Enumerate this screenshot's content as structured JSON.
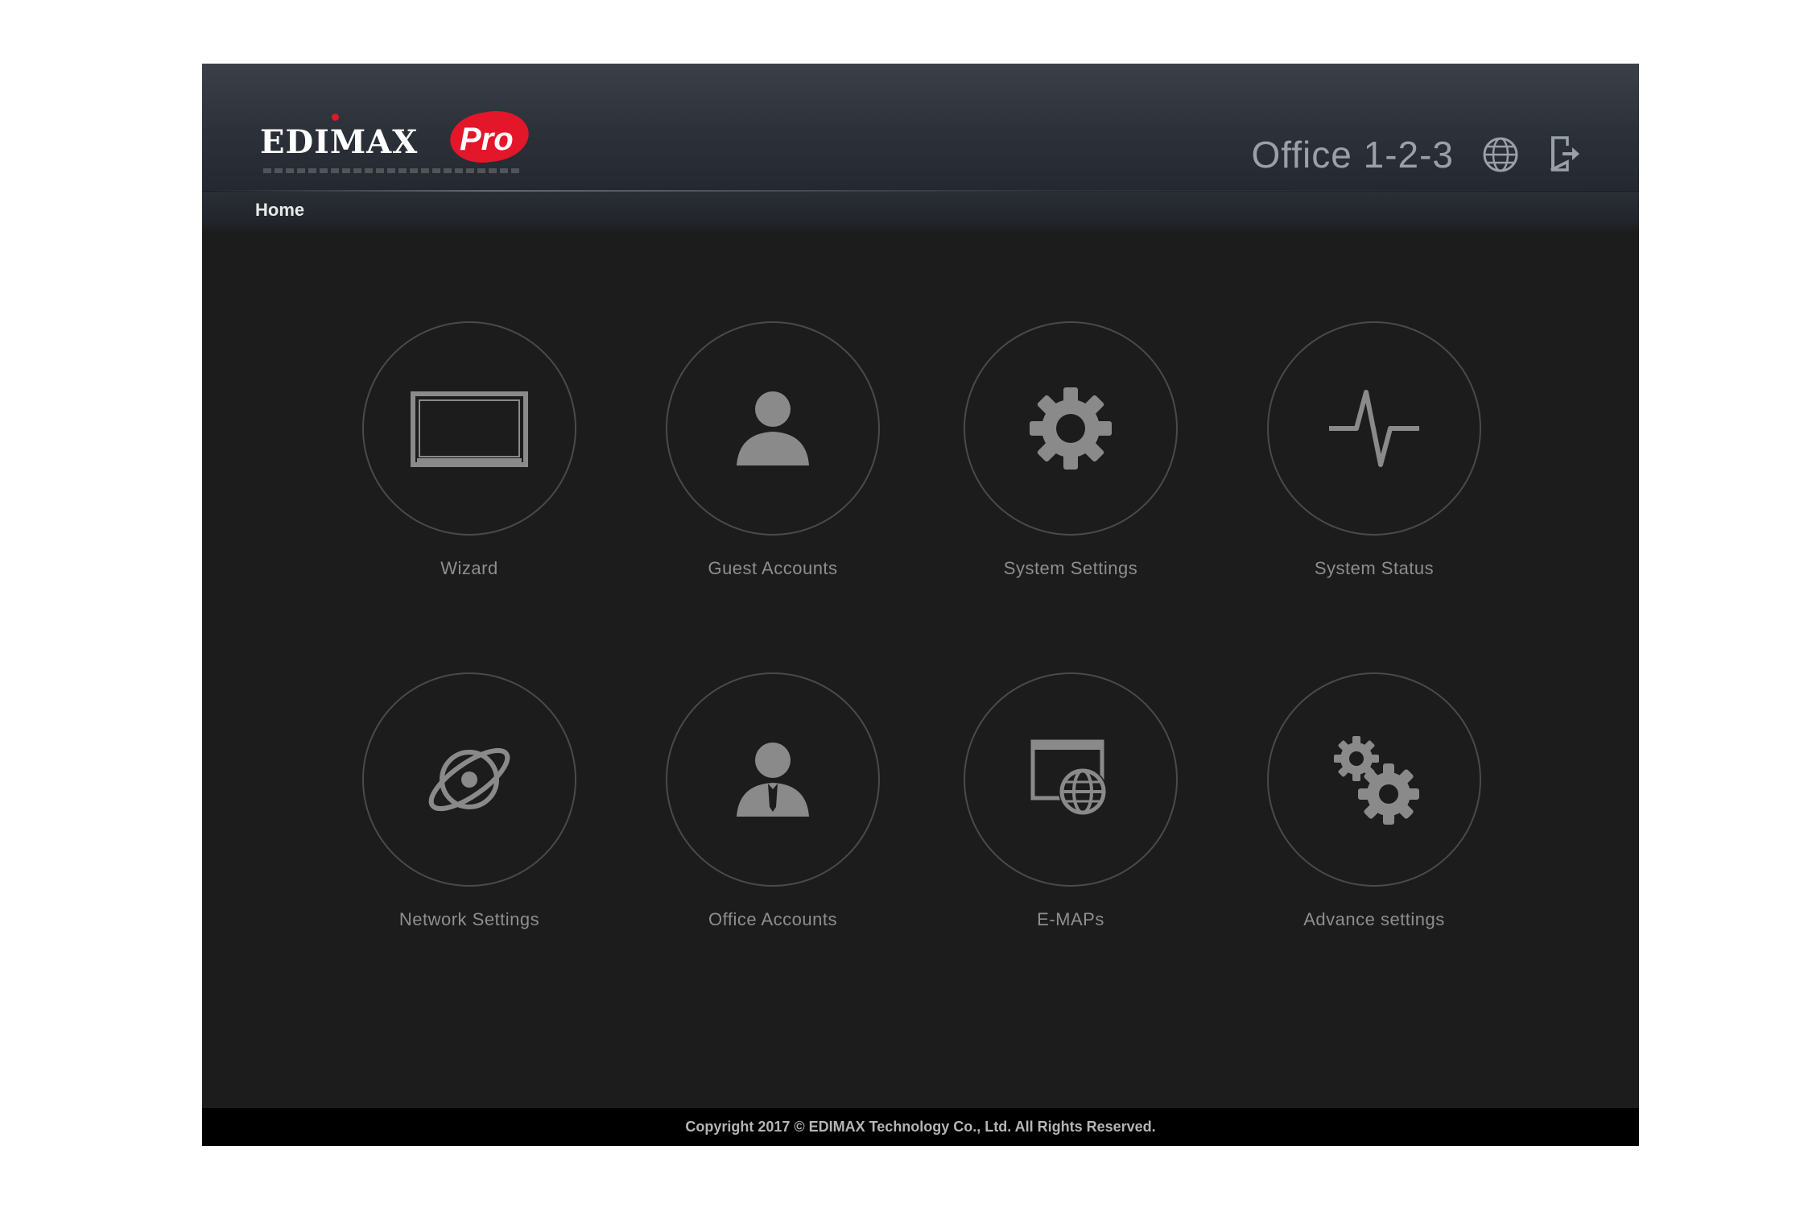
{
  "header": {
    "logo_text": "EDIMAX",
    "logo_badge": "Pro",
    "site_name": "Office 1-2-3",
    "language_icon": "globe-icon",
    "logout_icon": "logout-icon"
  },
  "breadcrumb": {
    "home": "Home"
  },
  "tiles": [
    {
      "label": "Wizard",
      "icon": "monitor-icon"
    },
    {
      "label": "Guest Accounts",
      "icon": "user-icon"
    },
    {
      "label": "System Settings",
      "icon": "gear-icon"
    },
    {
      "label": "System Status",
      "icon": "pulse-icon"
    },
    {
      "label": "Network Settings",
      "icon": "planet-icon"
    },
    {
      "label": "Office Accounts",
      "icon": "business-user-icon"
    },
    {
      "label": "E-MAPs",
      "icon": "map-globe-icon"
    },
    {
      "label": "Advance settings",
      "icon": "gears-icon"
    }
  ],
  "footer": {
    "copyright": "Copyright 2017 © EDIMAX Technology Co., Ltd. All Rights Reserved."
  },
  "colors": {
    "background": "#1c1c1c",
    "brand_red": "#e3162a",
    "icon_gray": "#8a8a8a"
  }
}
